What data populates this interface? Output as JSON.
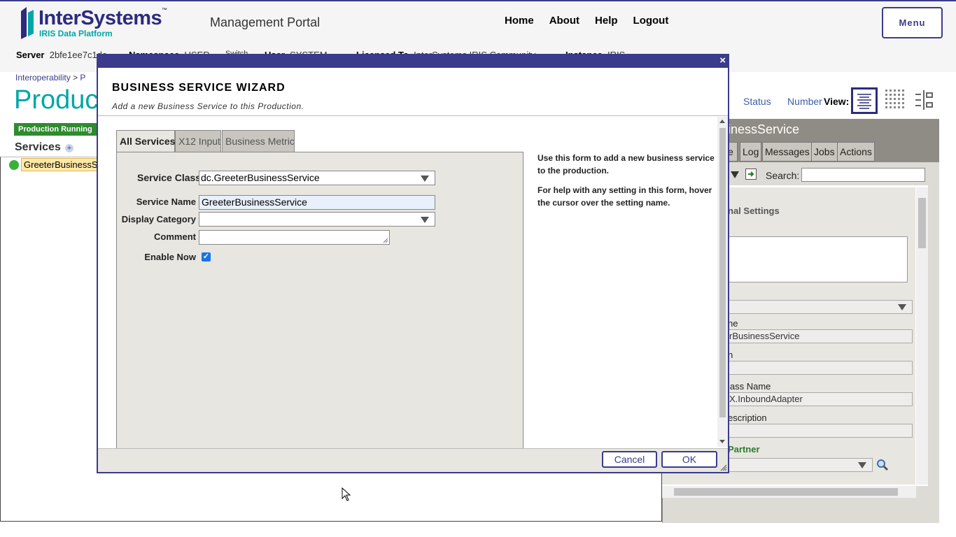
{
  "header": {
    "logo_name": "InterSystems",
    "logo_tm": "™",
    "logo_sub": "IRIS Data Platform",
    "portal_title": "Management Portal",
    "nav": [
      "Home",
      "About",
      "Help",
      "Logout"
    ],
    "menu_label": "Menu"
  },
  "infobar": {
    "server_label": "Server",
    "server_value": "2bfe1ee7c1de",
    "namespace_label": "Namespace",
    "namespace_value": "USER",
    "switch_label": "Switch",
    "user_label": "User",
    "user_value": "SYSTEM",
    "licensed_label": "Licensed To",
    "licensed_value": "InterSystems IRIS Community",
    "instance_label": "Instance",
    "instance_value": "IRIS"
  },
  "page": {
    "breadcrumb_1": "Interoperability",
    "breadcrumb_sep": ">",
    "breadcrumb_2": "P",
    "title": "Product",
    "status_badge": "Production Running",
    "services_header": "Services",
    "service_item": "GreeterBusinessService",
    "view_status": "Status",
    "view_number": "Number",
    "view_label": "View:"
  },
  "right_panel": {
    "title": "inessService",
    "tabs": [
      "e",
      "Log",
      "Messages",
      "Jobs",
      "Actions"
    ],
    "search_label": "Search:",
    "section": "nal Settings",
    "label_name": "ne",
    "value_name": "rBusinessService",
    "label_2": "n",
    "label_class": "lass Name",
    "value_class": "X.InboundAdapter",
    "label_desc": "escription",
    "label_partner": "Partner"
  },
  "wizard": {
    "close": "×",
    "title": "BUSINESS SERVICE WIZARD",
    "subtitle": "Add a new Business Service to this Production.",
    "tabs": [
      "All Services",
      "X12 Input",
      "Business Metric"
    ],
    "service_class_label": "Service Class",
    "service_class_value": "dc.GreeterBusinessService",
    "service_name_label": "Service Name",
    "service_name_value": "GreeterBusinessService",
    "display_category_label": "Display Category",
    "display_category_value": "",
    "comment_label": "Comment",
    "comment_value": "",
    "enable_now_label": "Enable Now",
    "enable_now_checked": true,
    "help_1": "Use this form to add a new business service to the production.",
    "help_2": "For help with any setting in this form, hover the cursor over the setting name.",
    "cancel_label": "Cancel",
    "ok_label": "OK"
  }
}
